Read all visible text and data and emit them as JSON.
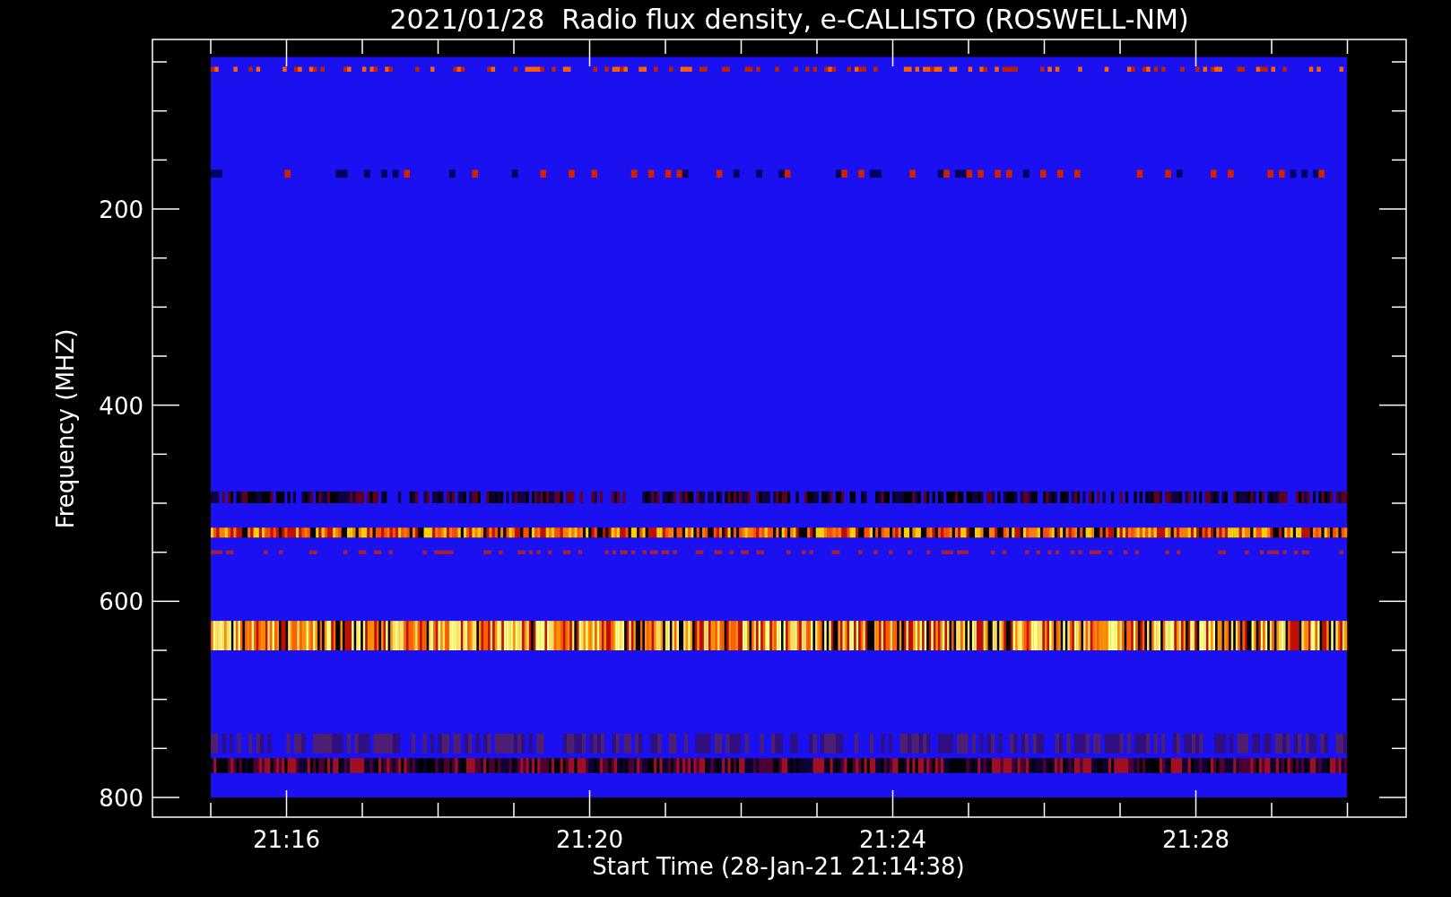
{
  "title": "2021/01/28  Radio flux density, e-CALLISTO (ROSWELL-NM)",
  "y_axis": {
    "label": "Frequency (MHZ)",
    "ticks": [
      "200",
      "400",
      "600",
      "800"
    ]
  },
  "x_axis": {
    "label": "Start Time (28-Jan-21 21:14:38)",
    "ticks": [
      "21:16",
      "21:20",
      "21:24",
      "21:28"
    ]
  }
}
